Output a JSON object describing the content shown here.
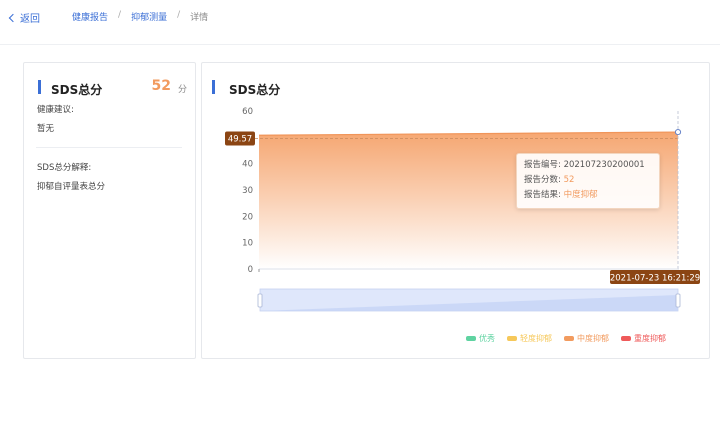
{
  "nav": {
    "back_label": "返回",
    "breadcrumb": [
      {
        "label": "健康报告"
      },
      {
        "label": "抑郁测量"
      },
      {
        "label": "详情"
      }
    ],
    "separator": "/"
  },
  "summary": {
    "title": "SDS总分",
    "score": "52",
    "score_unit": "分",
    "advice_label": "健康建议:",
    "advice_value": "暂无",
    "explain_label": "SDS总分解释:",
    "explain_value": "抑郁自评量表总分"
  },
  "chart_panel": {
    "title": "SDS总分"
  },
  "chart_data": {
    "type": "area",
    "x": [
      "2021-07-23 16:21:29"
    ],
    "series": [
      {
        "values": [
          52
        ]
      }
    ],
    "ylim": [
      0,
      60
    ],
    "yticks": [
      "0",
      "10",
      "20",
      "30",
      "40",
      "50",
      "60"
    ],
    "pointer_y_label": "49.57",
    "pointer_x_label": "2021-07-23 16:21:29",
    "grid": false,
    "legend_position": "bottom-right",
    "legend": [
      {
        "name": "优秀",
        "color": "#5fd3a1"
      },
      {
        "name": "轻度抑郁",
        "color": "#f6c85a"
      },
      {
        "name": "中度抑郁",
        "color": "#f29b5f"
      },
      {
        "name": "重度抑郁",
        "color": "#ef5a5a"
      }
    ],
    "colors": {
      "area_top": "#f5a26a",
      "area_bottom": "#ffffff",
      "line": "#f0955a",
      "marker_fill": "#8b4513"
    }
  },
  "tooltip": {
    "id_label": "报告编号:",
    "id_value": "202107230200001",
    "score_label": "报告分数:",
    "score_value": "52",
    "result_label": "报告结果:",
    "result_value": "中度抑郁"
  }
}
